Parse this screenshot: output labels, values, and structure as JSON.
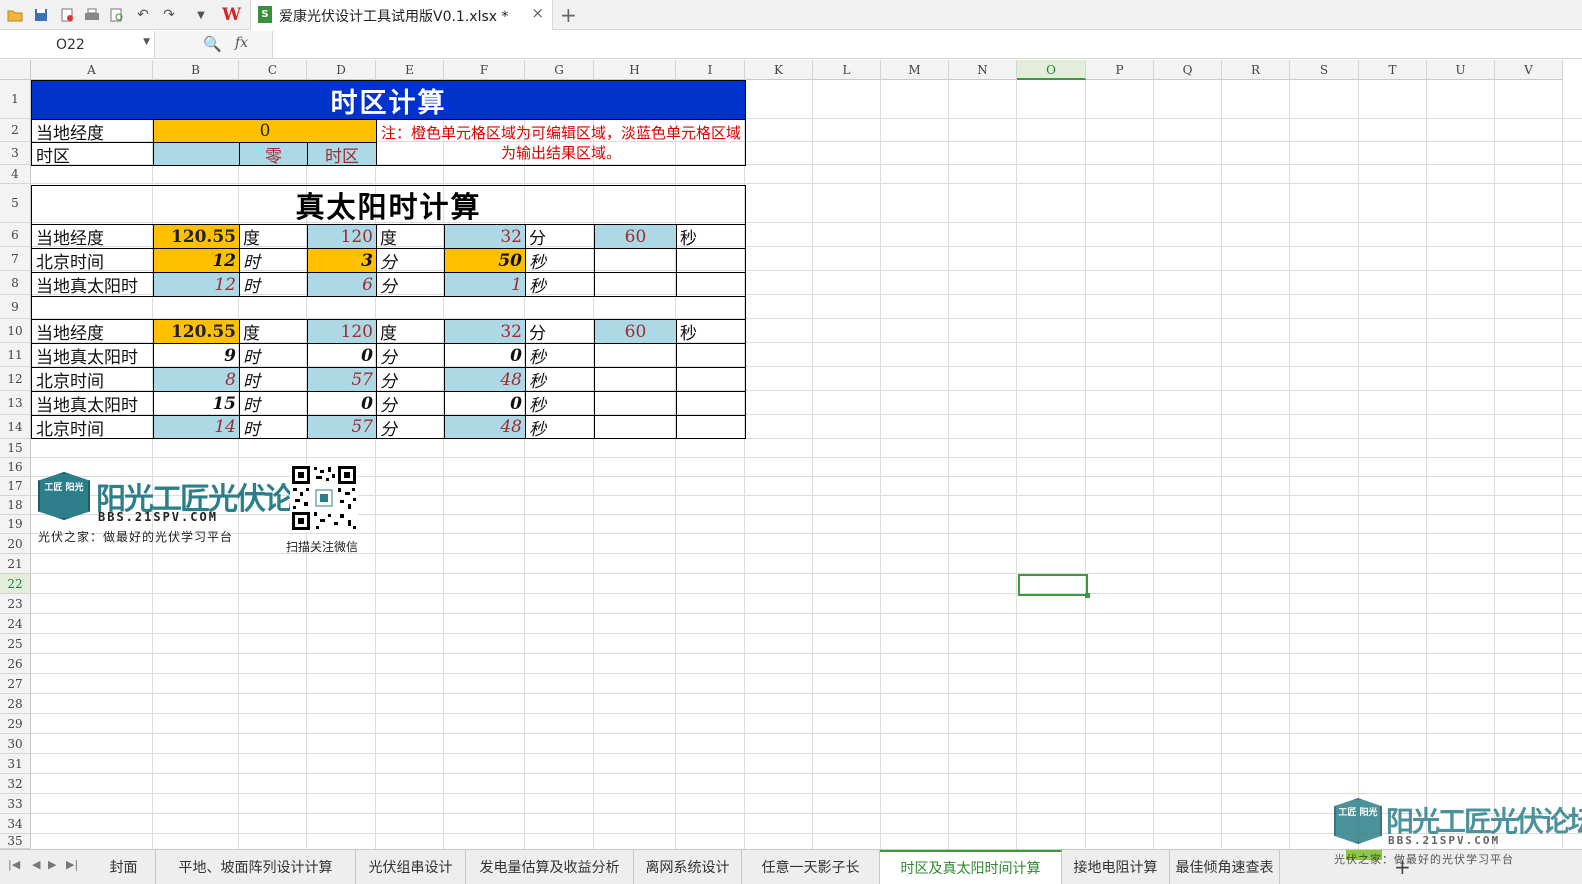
{
  "window": {
    "doc_title": "爱康光伏设计工具试用版V0.1.xlsx *",
    "close_label": "×",
    "new_tab_label": "+",
    "wps_logo": "W"
  },
  "quick_access_icons": [
    "open-icon",
    "save-icon",
    "export-icon",
    "print-icon",
    "preview-icon",
    "undo-icon",
    "redo-icon",
    "more-icon"
  ],
  "formula_bar": {
    "name_box": "O22",
    "fx_label": "fx",
    "formula": ""
  },
  "columns": [
    "A",
    "B",
    "C",
    "D",
    "E",
    "F",
    "G",
    "H",
    "I",
    "K",
    "L",
    "M",
    "N",
    "O",
    "P",
    "Q",
    "R",
    "S",
    "T",
    "U",
    "V"
  ],
  "rows": [
    "1",
    "2",
    "3",
    "4",
    "5",
    "6",
    "7",
    "8",
    "9",
    "10",
    "11",
    "12",
    "13",
    "14",
    "15",
    "16",
    "17",
    "18",
    "19",
    "20",
    "21",
    "22",
    "23",
    "24",
    "25",
    "26",
    "27",
    "28",
    "29",
    "30",
    "31",
    "32",
    "33",
    "34",
    "35"
  ],
  "sheet": {
    "title1": "时区计算",
    "longitude_label": "当地经度",
    "longitude_input": "0",
    "timezone_label": "时区",
    "timezone_value": "零",
    "timezone_unit": "时区",
    "note": "注：橙色单元格区域为可编辑区域，淡蓝色单元格区域为输出结果区域。",
    "title2": "真太阳时计算",
    "block1": {
      "r6": {
        "label": "当地经度",
        "v1": "120.55",
        "u1": "度",
        "v2": "120",
        "u2": "度",
        "v3": "32",
        "u3": "分",
        "v4": "60",
        "u4": "秒"
      },
      "r7": {
        "label": "北京时间",
        "v1": "12",
        "u1": "时",
        "v2": "3",
        "u2": "分",
        "v3": "50",
        "u3": "秒"
      },
      "r8": {
        "label": "当地真太阳时",
        "v1": "12",
        "u1": "时",
        "v2": "6",
        "u2": "分",
        "v3": "1",
        "u3": "秒"
      }
    },
    "block2": {
      "r10": {
        "label": "当地经度",
        "v1": "120.55",
        "u1": "度",
        "v2": "120",
        "u2": "度",
        "v3": "32",
        "u3": "分",
        "v4": "60",
        "u4": "秒"
      },
      "r11": {
        "label": "当地真太阳时",
        "v1": "9",
        "u1": "时",
        "v2": "0",
        "u2": "分",
        "v3": "0",
        "u3": "秒"
      },
      "r12": {
        "label": "北京时间",
        "v1": "8",
        "u1": "时",
        "v2": "57",
        "u2": "分",
        "v3": "48",
        "u3": "秒"
      },
      "r13": {
        "label": "当地真太阳时",
        "v1": "15",
        "u1": "时",
        "v2": "0",
        "u2": "分",
        "v3": "0",
        "u3": "秒"
      },
      "r14": {
        "label": "北京时间",
        "v1": "14",
        "u1": "时",
        "v2": "57",
        "u2": "分",
        "v3": "48",
        "u3": "秒"
      }
    }
  },
  "logo": {
    "badge": "工匠 阳光",
    "name": "阳光工匠光伏论坛",
    "url": "BBS.21SPV.COM",
    "slogan": "光伏之家：做最好的光伏学习平台",
    "qr_caption": "扫描关注微信"
  },
  "sheet_tabs": [
    "封面",
    "平地、坡面阵列设计计算",
    "光伏组串设计",
    "发电量估算及收益分析",
    "离网系统设计",
    "任意一天影子长",
    "时区及真太阳时间计算",
    "接地电阻计算",
    "最佳倾角速查表"
  ],
  "active_tab": "时区及真太阳时间计算",
  "add_sheet_label": "+",
  "colors": {
    "orange_input": "#ffc000",
    "blue_output": "#add8e6",
    "title_blue": "#0033cc",
    "note_red": "#e00000",
    "accent_green": "#3c9a3c"
  }
}
